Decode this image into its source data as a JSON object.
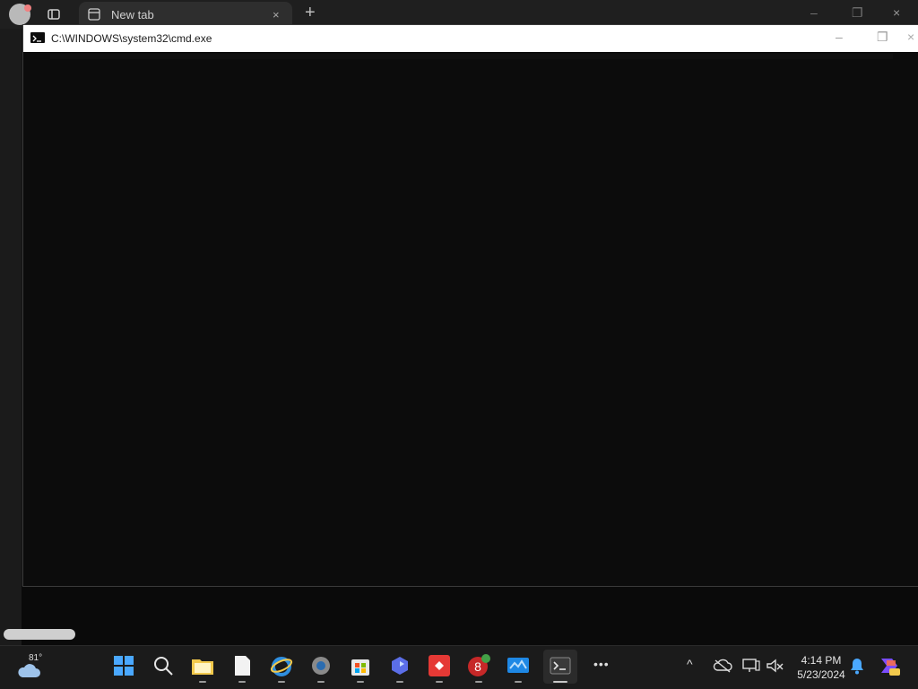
{
  "browser": {
    "tab_title": "New tab",
    "tab_close_glyph": "×",
    "new_tab_glyph": "+",
    "min_glyph": "–",
    "max_glyph": "❐",
    "close_glyph": "×"
  },
  "cmd": {
    "title": "C:\\WINDOWS\\system32\\cmd.exe",
    "min_glyph": "–",
    "max_glyph": "❐",
    "close_glyph": "×"
  },
  "taskbar": {
    "weather_temp": "81°",
    "apps": [
      {
        "name": "start-icon",
        "ind": false
      },
      {
        "name": "search-icon",
        "ind": false
      },
      {
        "name": "file-explorer-icon",
        "ind": true
      },
      {
        "name": "notepad-icon",
        "ind": true
      },
      {
        "name": "internet-explorer-icon",
        "ind": true
      },
      {
        "name": "settings-icon",
        "ind": true
      },
      {
        "name": "store-icon",
        "ind": true
      },
      {
        "name": "copilot-icon",
        "ind": true
      },
      {
        "name": "anydesk-icon",
        "ind": true
      },
      {
        "name": "eight-icon",
        "ind": true
      },
      {
        "name": "monitor-icon",
        "ind": true
      },
      {
        "name": "terminal-icon",
        "ind": true
      }
    ],
    "more_glyph": "•••",
    "chevron_glyph": "^",
    "time": "4:14 PM",
    "date": "5/23/2024"
  }
}
